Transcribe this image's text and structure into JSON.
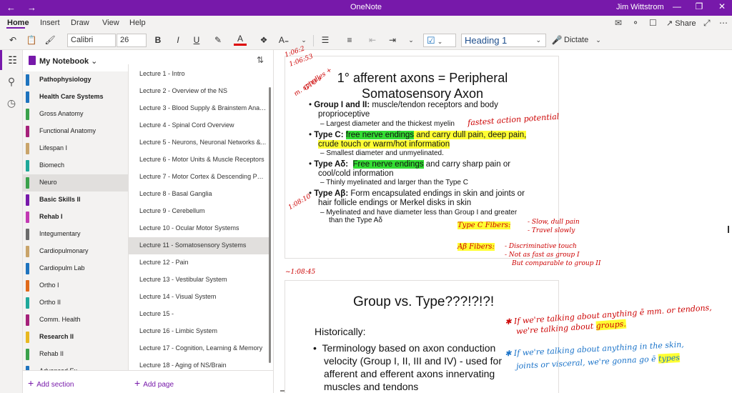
{
  "titlebar": {
    "back_icon": "back-arrow-icon",
    "forward_icon": "forward-arrow-icon",
    "title": "OneNote",
    "user": "Jim Wittstrom"
  },
  "menu": {
    "tabs": [
      "Home",
      "Insert",
      "Draw",
      "View",
      "Help"
    ],
    "active": "Home",
    "share_label": "Share"
  },
  "ribbon": {
    "font_name": "Calibri",
    "font_size": "26",
    "bold": "B",
    "italic": "I",
    "underline": "U",
    "strike": "ab",
    "style": "Heading 1",
    "dictate": "Dictate"
  },
  "notebook": {
    "name": "My Notebook"
  },
  "sections": [
    {
      "label": "Pathophysiology",
      "bold": true,
      "color": "#1e73be"
    },
    {
      "label": "Health Care Systems",
      "bold": true,
      "color": "#1e73be"
    },
    {
      "label": "Gross Anatomy",
      "bold": false,
      "color": "#3aa14b"
    },
    {
      "label": "Functional Anatomy",
      "bold": false,
      "color": "#a5217a"
    },
    {
      "label": "Lifespan I",
      "bold": false,
      "color": "#c9a46a"
    },
    {
      "label": "Biomech",
      "bold": false,
      "color": "#1fa89a"
    },
    {
      "label": "Neuro",
      "bold": false,
      "color": "#3aa14b"
    },
    {
      "label": "Basic Skills II",
      "bold": true,
      "color": "#7719aa"
    },
    {
      "label": "Rehab I",
      "bold": true,
      "color": "#c239b3"
    },
    {
      "label": "Integumentary",
      "bold": false,
      "color": "#6b6b6b"
    },
    {
      "label": "Cardiopulmonary",
      "bold": false,
      "color": "#c9a46a"
    },
    {
      "label": "Cardiopulm Lab",
      "bold": false,
      "color": "#1e73be"
    },
    {
      "label": "Ortho I",
      "bold": false,
      "color": "#e06a1b"
    },
    {
      "label": "Ortho II",
      "bold": false,
      "color": "#1fa89a"
    },
    {
      "label": "Comm. Health",
      "bold": false,
      "color": "#a5217a"
    },
    {
      "label": "Research II",
      "bold": true,
      "color": "#e8b821"
    },
    {
      "label": "Rehab II",
      "bold": false,
      "color": "#3aa14b"
    },
    {
      "label": "Advanced Ex",
      "bold": false,
      "color": "#1e73be"
    }
  ],
  "pages": [
    "Lecture 1 - Intro",
    "Lecture 2 - Overview of the NS",
    "Lecture 3 - Blood Supply & Brainstem Anato...",
    "Lecture 4 - Spinal Cord Overview",
    "Lecture 5 - Neurons, Neuronal Networks &...",
    "Lecture 6 - Motor Units & Muscle Receptors",
    "Lecture 7 - Motor Cortex & Descending Path...",
    "Lecture 8 - Basal Ganglia",
    "Lecture 9 - Cerebellum",
    "Lecture 10 - Ocular Motor Systems",
    "Lecture 11 - Somatosensory Systems",
    "Lecture 12 - Pain",
    "Lecture 13 - Vestibular System",
    "Lecture 14 - Visual System",
    "Lecture 15 -",
    "Lecture 16 - Limbic System",
    "Lecture 17 - Cognition, Learning & Memory",
    "Lecture 18 - Aging of NS/Brain"
  ],
  "footer": {
    "add_section": "Add section",
    "add_page": "Add page"
  },
  "slide1": {
    "title_line1": "1° afferent axons = Peripheral",
    "title_line2": "Somatosensory Axon",
    "b1_label": "Group I and II:",
    "b1_text": " muscle/tendon receptors and body",
    "b1_text2": "proprioceptive",
    "b1_sub": "Largest diameter and the thickest myelin",
    "b2_label": "Type C:",
    "b2_hl_green": "free nerve endings",
    "b2_hl_yellow1": " and carry dull pain, deep pain,",
    "b2_hl_yellow2": "crude touch or warm/hot information",
    "b2_sub": "Smallest diameter and unmyelinated.",
    "b3_label": "Type Aδ:",
    "b3_hl_green": "Free nerve endings",
    "b3_text": " and carry sharp pain or",
    "b3_text2": "cool/cold information",
    "b3_sub": "Thinly myelinated and larger than the Type C",
    "b4_label": "Type Aβ:",
    "b4_text": " Form encapsulated endings in skin and joints or",
    "b4_text2": "hair follicle endings or Merkel disks in skin",
    "b4_sub1": "Myelinated and have diameter less than Group I and greater",
    "b4_sub2": "than the Type Aδ"
  },
  "ink": {
    "t1": "1:06:2",
    "t2": "1:06:53",
    "spindles1": "m. spindles +",
    "spindles2": "GTO's",
    "fastest": "fastest action potential",
    "t3": "1:08:10",
    "typec": "Type C Fibers:",
    "typec_n1": "- Slow, dull pain",
    "typec_n2": "- Travel slowly",
    "abfibers": "Aβ Fibers:",
    "ab_n1": "- Discriminative touch",
    "ab_n2": "- Not as fast as group I",
    "ab_n3": "But comparable to group II",
    "t4": "~1:08:45",
    "r1": "✱ If we're talking about anything ē mm. or tendons,",
    "r2": "we're talking about",
    "r2_hl": "groups.",
    "b1": "✱ If we're talking about anything in the skin,",
    "b2": "joints or visceral, we're gonna go ē",
    "b2_hl": "types"
  },
  "slide2": {
    "title": "Group vs. Type???!?!?!",
    "sub": "Historically:",
    "bullet1": "Terminology based on axon conduction",
    "bullet2": "velocity (Group I, II, III and IV) - used for",
    "bullet3": "afferent and efferent axons innervating",
    "bullet4": "muscles and tendons"
  }
}
